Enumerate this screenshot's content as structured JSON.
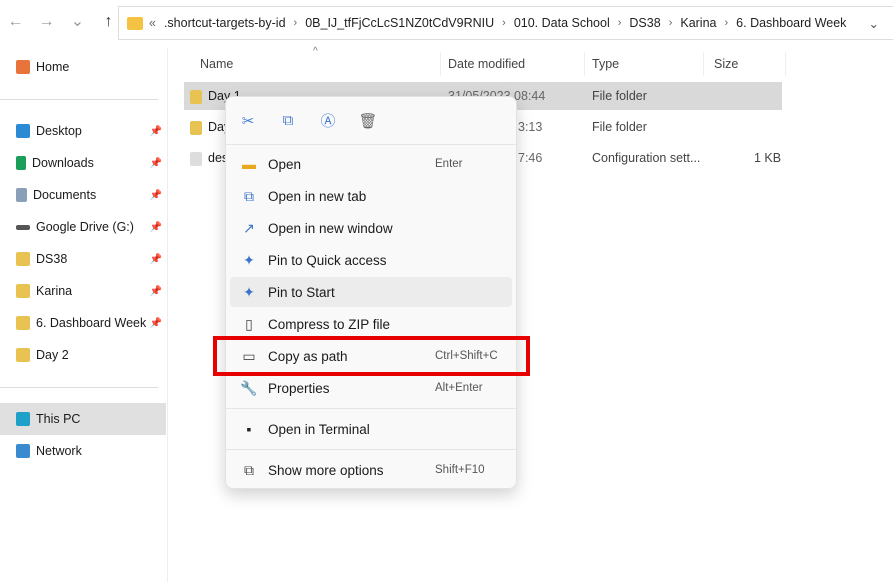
{
  "nav": {
    "back": "←",
    "forward": "→",
    "recent": "⌄",
    "up": "↑"
  },
  "address": {
    "overflow": "«",
    "crumbs": [
      ".shortcut-targets-by-id",
      "0B_IJ_tfFjCcLcS1NZ0tCdV9RNIU",
      "010. Data School",
      "DS38",
      "Karina",
      "6. Dashboard Week"
    ],
    "sep": "›",
    "dropdown": "⌄"
  },
  "sidebar": {
    "home": "Home",
    "items": [
      {
        "label": "Desktop",
        "color": "#2a8ad4"
      },
      {
        "label": "Downloads",
        "color": "#1b9e5a"
      },
      {
        "label": "Documents",
        "color": "#8aa0b8"
      },
      {
        "label": "Google Drive (G:)",
        "color": "#555555"
      },
      {
        "label": "DS38",
        "color": "#e8c351"
      },
      {
        "label": "Karina",
        "color": "#e8c351"
      },
      {
        "label": "6. Dashboard Week",
        "color": "#e8c351"
      },
      {
        "label": "Day 2",
        "color": "#e8c351"
      }
    ],
    "this_pc": "This PC",
    "network": "Network",
    "pin": "📌"
  },
  "columns": {
    "name": "Name",
    "date": "Date modified",
    "type": "Type",
    "size": "Size",
    "sort": "^"
  },
  "files": [
    {
      "name": "Day 1",
      "date": "31/05/2023 08:44",
      "type": "File folder",
      "size": ""
    },
    {
      "name": "Day 2",
      "date": "3:13",
      "type": "File folder",
      "size": ""
    },
    {
      "name": "desktop.ini",
      "date": "7:46",
      "type": "Configuration sett...",
      "size": "1 KB"
    }
  ],
  "menu": {
    "tools": [
      "✂",
      "⧉",
      "Ⓐ",
      "🗑"
    ],
    "items": [
      {
        "label": "Open",
        "shortcut": "Enter",
        "icon": "▬"
      },
      {
        "label": "Open in new tab",
        "shortcut": "",
        "icon": "⧉"
      },
      {
        "label": "Open in new window",
        "shortcut": "",
        "icon": "↗"
      },
      {
        "label": "Pin to Quick access",
        "shortcut": "",
        "icon": "✦"
      },
      {
        "label": "Pin to Start",
        "shortcut": "",
        "icon": "✦"
      },
      {
        "label": "Compress to ZIP file",
        "shortcut": "",
        "icon": "▯"
      },
      {
        "label": "Copy as path",
        "shortcut": "Ctrl+Shift+C",
        "icon": "▭"
      },
      {
        "label": "Properties",
        "shortcut": "Alt+Enter",
        "icon": "🔧"
      },
      {
        "label": "Open in Terminal",
        "shortcut": "",
        "icon": "▪"
      },
      {
        "label": "Show more options",
        "shortcut": "Shift+F10",
        "icon": "⧉"
      }
    ]
  },
  "highlight_color": "#e60000"
}
